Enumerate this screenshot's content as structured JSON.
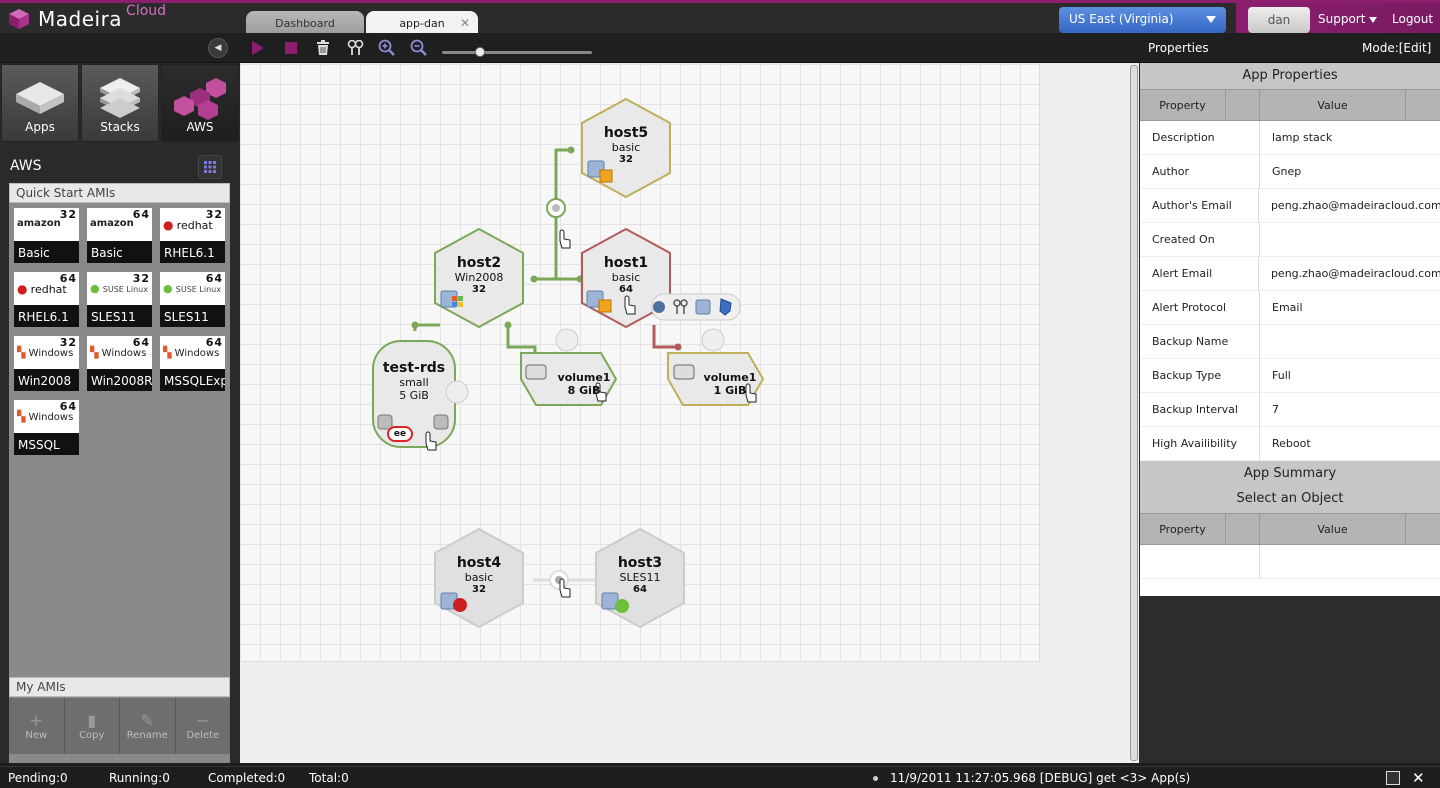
{
  "app": {
    "name": "Madeira",
    "name_sup": "Cloud"
  },
  "tabs": [
    {
      "label": "Dashboard"
    },
    {
      "label": "app-dan"
    }
  ],
  "header": {
    "region": "US East (Virginia)",
    "user": "dan",
    "support": "Support",
    "logout": "Logout"
  },
  "toolbar": {
    "properties_title": "Properties",
    "mode": "Mode:[Edit]",
    "zoom_level": 0.25
  },
  "left": {
    "categories": [
      {
        "label": "Apps"
      },
      {
        "label": "Stacks"
      },
      {
        "label": "AWS"
      }
    ],
    "aws_title": "AWS",
    "quick_start_title": "Quick Start AMIs",
    "amis": [
      {
        "name": "Basic",
        "bits": "32",
        "logo": "amazon"
      },
      {
        "name": "Basic",
        "bits": "64",
        "logo": "amazon"
      },
      {
        "name": "RHEL6.1",
        "bits": "32",
        "logo": "redhat"
      },
      {
        "name": "RHEL6.1",
        "bits": "64",
        "logo": "redhat"
      },
      {
        "name": "SLES11",
        "bits": "32",
        "logo": "suse"
      },
      {
        "name": "SLES11",
        "bits": "64",
        "logo": "suse"
      },
      {
        "name": "Win2008",
        "bits": "32",
        "logo": "windows"
      },
      {
        "name": "Win2008R2",
        "bits": "64",
        "logo": "windows"
      },
      {
        "name": "MSSQLExp",
        "bits": "64",
        "logo": "windows"
      },
      {
        "name": "MSSQL",
        "bits": "64",
        "logo": "windows"
      }
    ],
    "logos": {
      "amazon": "amazon",
      "amazon_sub": "webservices",
      "redhat": "redhat",
      "suse": "SUSE Linux",
      "suse_sub": "Enterprise",
      "windows": "Windows"
    },
    "my_amis_title": "My AMIs",
    "actions": [
      {
        "label": "New",
        "icon": "+"
      },
      {
        "label": "Copy",
        "icon": "▮"
      },
      {
        "label": "Rename",
        "icon": "✎"
      },
      {
        "label": "Delete",
        "icon": "−"
      }
    ]
  },
  "diagram": {
    "host5": {
      "name": "host5",
      "sub": "basic",
      "bits": "32"
    },
    "host2": {
      "name": "host2",
      "sub": "Win2008",
      "bits": "32"
    },
    "host1": {
      "name": "host1",
      "sub": "basic",
      "bits": "64"
    },
    "rds": {
      "name": "test-rds",
      "sub": "small",
      "size": "5 GiB",
      "badge": "ee"
    },
    "vol_a": {
      "name": "volume1",
      "size": "8 GiB"
    },
    "vol_b": {
      "name": "volume1",
      "size": "1 GiB"
    },
    "host4": {
      "name": "host4",
      "sub": "basic",
      "bits": "32"
    },
    "host3": {
      "name": "host3",
      "sub": "SLES11",
      "bits": "64"
    }
  },
  "properties": {
    "title": "App Properties",
    "col_property": "Property",
    "col_value": "Value",
    "rows": [
      {
        "key": "Description",
        "value": "lamp stack"
      },
      {
        "key": "Author",
        "value": "Gnep"
      },
      {
        "key": "Author's Email",
        "value": "peng.zhao@madeiracloud.com"
      },
      {
        "key": "Created On",
        "value": ""
      },
      {
        "key": "Alert Email",
        "value": "peng.zhao@madeiracloud.com"
      },
      {
        "key": "Alert Protocol",
        "value": "Email"
      },
      {
        "key": "Backup Name",
        "value": ""
      },
      {
        "key": "Backup Type",
        "value": "Full"
      },
      {
        "key": "Backup Interval",
        "value": "7"
      },
      {
        "key": "High Availibility",
        "value": "Reboot"
      }
    ],
    "summary_title": "App Summary",
    "summary_sub": "Select an Object"
  },
  "status": {
    "pending": "Pending:0",
    "running": "Running:0",
    "completed": "Completed:0",
    "total": "Total:0",
    "log": "11/9/2011 11:27:05.968 [DEBUG] get <3> App(s)"
  },
  "colors": {
    "brand": "#8b1f6e",
    "region": "#3f72cf",
    "green": "#7aa858",
    "red": "#b35a5a",
    "olive": "#bfae5a"
  }
}
